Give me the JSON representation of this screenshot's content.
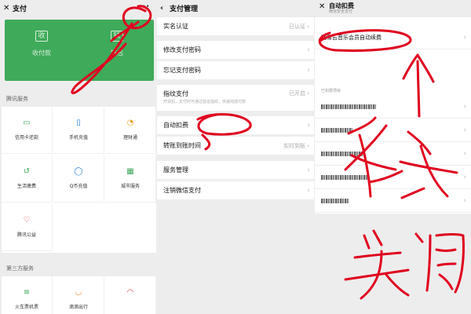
{
  "panel1": {
    "title": "支付",
    "more": "···",
    "card_items": [
      {
        "icon": "收",
        "label": "收付款"
      },
      {
        "icon": "钱",
        "label": "钱包"
      }
    ],
    "section1": "腾讯服务",
    "services": [
      {
        "icon": "▭",
        "label": "信用卡还款"
      },
      {
        "icon": "▯",
        "label": "手机充值"
      },
      {
        "icon": "◔",
        "label": "理财通"
      },
      {
        "icon": "↺",
        "label": "生活缴费"
      },
      {
        "icon": "◯",
        "label": "Q币充值"
      },
      {
        "icon": "▦",
        "label": "城市服务"
      },
      {
        "icon": "♡",
        "label": "腾讯公益"
      }
    ],
    "section2": "第三方服务",
    "third": [
      {
        "icon": "≡",
        "label": "火车票机票"
      },
      {
        "icon": "◡",
        "label": "滴滴出行"
      },
      {
        "icon": "◠",
        "label": ""
      }
    ]
  },
  "panel2": {
    "back": "‹",
    "title": "支付管理",
    "rows": [
      {
        "label": "实名认证",
        "right": "已认证 ›"
      },
      {
        "label": "修改支付密码",
        "right": ""
      },
      {
        "label": "忘记支付密码",
        "right": ""
      },
      {
        "label": "指纹支付",
        "right": "已开启 ›",
        "sub": "开启后，支付时可通过验证指纹，快速完成付款"
      },
      {
        "label": "自动扣费",
        "right": ""
      },
      {
        "label": "转账到账时间",
        "right": "实时到账 ›"
      },
      {
        "label": "服务管理",
        "right": ""
      },
      {
        "label": "注销微信支付",
        "right": ""
      }
    ]
  },
  "panel3": {
    "close": "✕",
    "title": "自动扣费",
    "subtitle": "微信安全支付",
    "first_item": "网易云音乐会员自动续费",
    "header2": "已扣费项目"
  },
  "annotation_text": [
    "关",
    "闭"
  ],
  "colors": {
    "green": "#3faa5a",
    "ink": "#e0001e"
  }
}
